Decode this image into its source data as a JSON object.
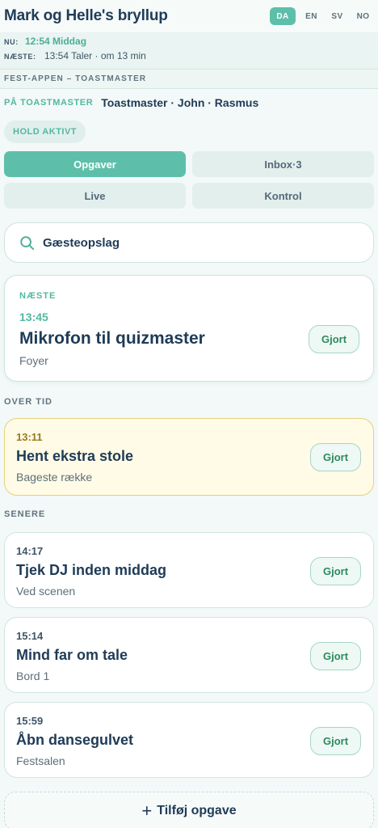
{
  "app": {
    "title": "Mark og Helle's bryllup"
  },
  "languages": [
    {
      "code": "DA",
      "active": true
    },
    {
      "code": "EN",
      "active": false
    },
    {
      "code": "SV",
      "active": false
    },
    {
      "code": "NO",
      "active": false
    }
  ],
  "status": {
    "now_key": "NU:",
    "now_value": "12:54 Middag",
    "next_key": "NÆSTE:",
    "next_value": "13:54 Taler · om 13 min"
  },
  "section": {
    "label": "FEST-APPEN – TOASTMASTER"
  },
  "role": {
    "key": "PÅ TOASTMASTER",
    "names": "Toastmaster · John · Rasmus"
  },
  "hold_chip": "HOLD AKTIVT",
  "tabs": [
    {
      "label": "Opgaver",
      "active": true
    },
    {
      "label": "Inbox·3",
      "active": false
    },
    {
      "label": "Live",
      "active": false
    },
    {
      "label": "Kontrol",
      "active": false
    }
  ],
  "search": {
    "label": "Gæsteopslag",
    "icon": "search-icon"
  },
  "next_task": {
    "label": "NÆSTE",
    "time": "13:45",
    "title": "Mikrofon til quizmaster",
    "place": "Foyer",
    "done_label": "Gjort"
  },
  "overdue": {
    "heading": "OVER TID",
    "tasks": [
      {
        "time": "13:11",
        "title": "Hent ekstra stole",
        "place": "Bageste række",
        "done_label": "Gjort"
      }
    ]
  },
  "later": {
    "heading": "SENERE",
    "tasks": [
      {
        "time": "14:17",
        "title": "Tjek DJ inden middag",
        "place": "Ved scenen",
        "done_label": "Gjort"
      },
      {
        "time": "15:14",
        "title": "Mind far om tale",
        "place": "Bord 1",
        "done_label": "Gjort"
      },
      {
        "time": "15:59",
        "title": "Åbn dansegulvet",
        "place": "Festsalen",
        "done_label": "Gjort"
      }
    ]
  },
  "add_task": {
    "label": "Tilføj opgave",
    "icon": "plus-icon"
  },
  "colors": {
    "accent": "#5dbfaa",
    "title": "#1f3b57",
    "overdue_bg": "#fffbe6",
    "overdue_border": "#e6cf7a",
    "done_text": "#2d8a5d"
  }
}
